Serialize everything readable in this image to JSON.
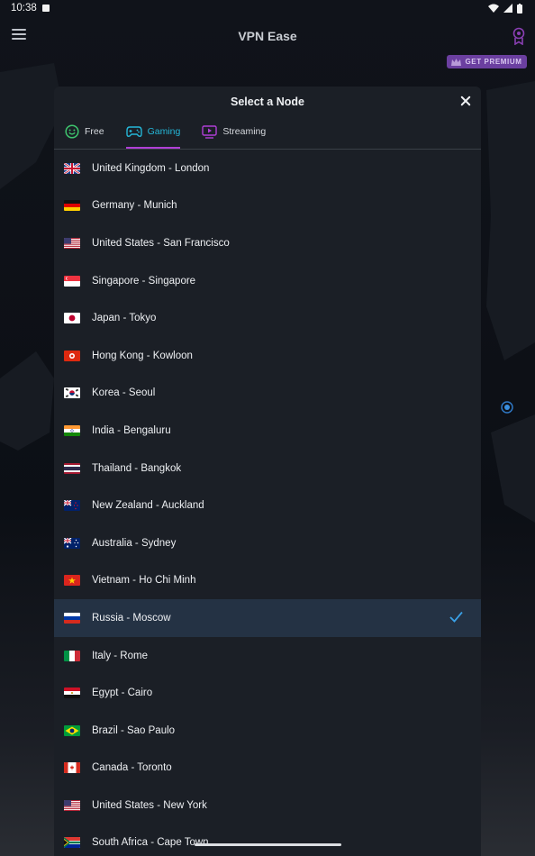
{
  "status_bar": {
    "time": "10:38"
  },
  "app_bar": {
    "title": "VPN Ease",
    "premium_label": "GET PREMIUM"
  },
  "sheet": {
    "title": "Select a Node",
    "tabs": [
      {
        "label": "Free",
        "icon": "smiley-icon"
      },
      {
        "label": "Gaming",
        "icon": "gamepad-icon",
        "active": true
      },
      {
        "label": "Streaming",
        "icon": "play-screen-icon"
      }
    ],
    "nodes": [
      {
        "label": "United Kingdom - London",
        "flag": "uk"
      },
      {
        "label": "Germany - Munich",
        "flag": "de"
      },
      {
        "label": "United States - San Francisco",
        "flag": "us"
      },
      {
        "label": "Singapore - Singapore",
        "flag": "sg"
      },
      {
        "label": "Japan - Tokyo",
        "flag": "jp"
      },
      {
        "label": "Hong Kong - Kowloon",
        "flag": "hk"
      },
      {
        "label": "Korea - Seoul",
        "flag": "kr"
      },
      {
        "label": "India - Bengaluru",
        "flag": "in"
      },
      {
        "label": "Thailand - Bangkok",
        "flag": "th"
      },
      {
        "label": "New Zealand - Auckland",
        "flag": "nz"
      },
      {
        "label": "Australia - Sydney",
        "flag": "au"
      },
      {
        "label": "Vietnam - Ho Chi Minh",
        "flag": "vn"
      },
      {
        "label": "Russia - Moscow",
        "flag": "ru",
        "selected": true
      },
      {
        "label": "Italy - Rome",
        "flag": "it"
      },
      {
        "label": "Egypt - Cairo",
        "flag": "eg"
      },
      {
        "label": "Brazil - Sao Paulo",
        "flag": "br"
      },
      {
        "label": "Canada - Toronto",
        "flag": "ca"
      },
      {
        "label": "United States - New York",
        "flag": "us"
      },
      {
        "label": "South Africa - Cape Town",
        "flag": "za"
      }
    ]
  },
  "colors": {
    "accent_active_tab": "#25b7d8",
    "tab_indicator": "#b03fd6",
    "free_icon": "#3ec46d",
    "streaming_icon": "#b03fd6",
    "selected_row": "#243244",
    "check": "#3aa0e6",
    "premium_bg": "#6b3fa0"
  }
}
